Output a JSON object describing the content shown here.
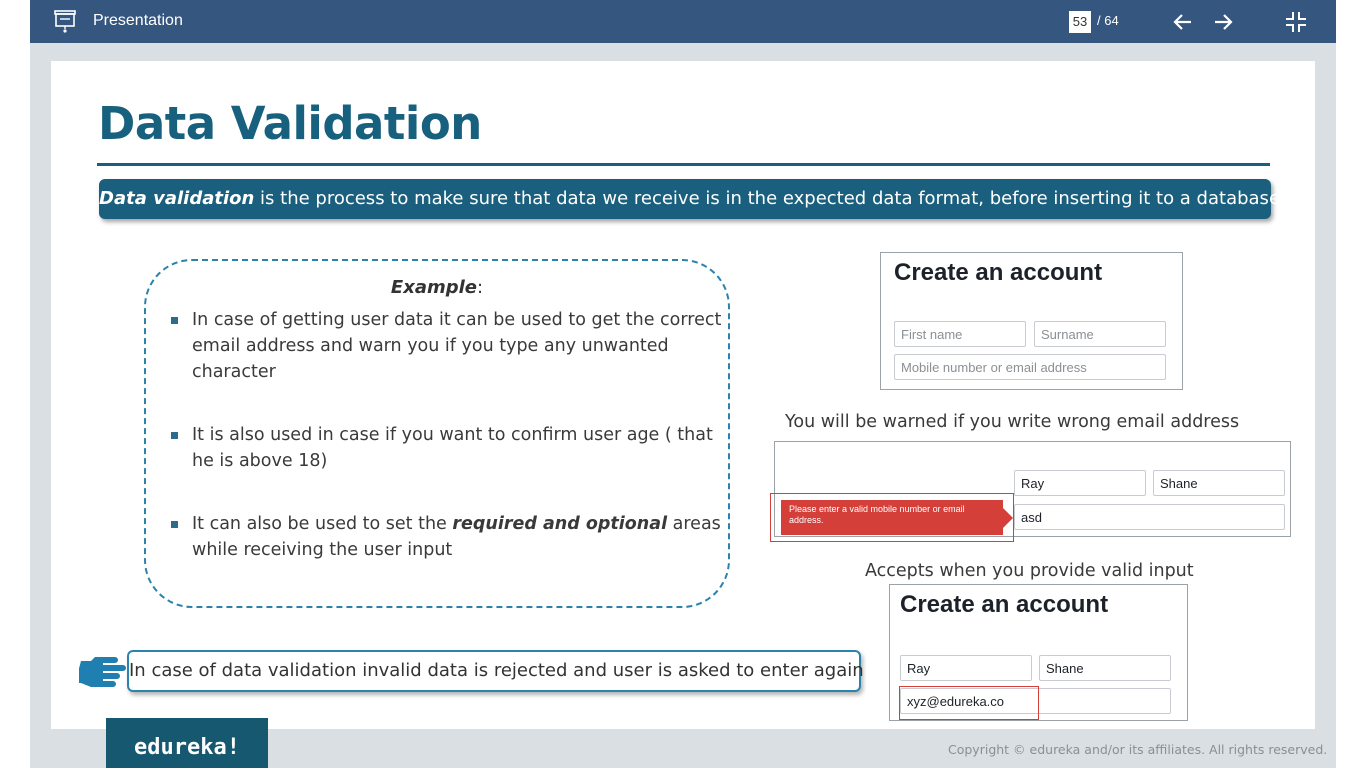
{
  "toolbar": {
    "title": "Presentation",
    "current_page": "53",
    "total_pages": "/ 64"
  },
  "slide": {
    "title": "Data Validation",
    "definition_term": "Data validation",
    "definition_rest": " is the process to make sure that data we receive is in the expected data format, before inserting it to a database",
    "example_label": "Example",
    "example_colon": ":",
    "bullets": [
      "In case of getting user data it can be used to get the correct email address and warn you if you type any unwanted character",
      "It is also used in case if you want to confirm user age ( that he is above 18)",
      {
        "pre": "It can also be used to set the ",
        "em": "required and optional",
        "post": " areas while receiving the user input"
      }
    ],
    "note": "In case of data validation invalid data is rejected and user is asked to enter again",
    "form1": {
      "title": "Create an account",
      "first_name_placeholder": "First name",
      "surname_placeholder": "Surname",
      "contact_placeholder": "Mobile number or email address"
    },
    "caption_warn": "You will be warned if you write wrong email address",
    "form2": {
      "first_name": "Ray",
      "surname": "Shane",
      "contact": "asd",
      "error": "Please enter a valid mobile number or email address."
    },
    "caption_accept": "Accepts when you provide valid input",
    "form3": {
      "title": "Create an account",
      "first_name": "Ray",
      "surname": "Shane",
      "contact": "xyz@edureka.co"
    },
    "logo": "edureka!",
    "copyright": "Copyright © edureka and/or its affiliates. All rights reserved."
  },
  "colors": {
    "toolbar": "#35567e",
    "title": "#17607e",
    "accent": "#2b82ab",
    "error": "#d43f3a"
  }
}
